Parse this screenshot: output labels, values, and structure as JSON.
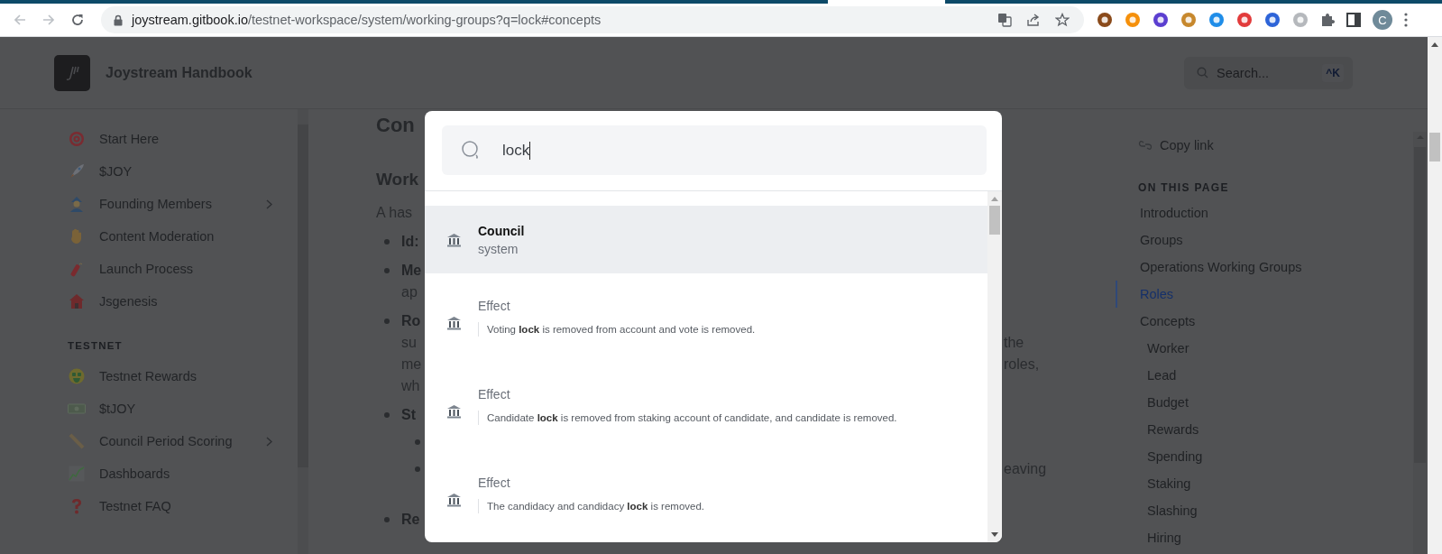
{
  "browser": {
    "url_host": "joystream.gitbook.io",
    "url_path": "/testnet-workspace/system/working-groups?q=lock#concepts",
    "profile_initial": "C"
  },
  "header": {
    "title": "Joystream Handbook",
    "search_placeholder": "Search...",
    "shortcut": "^K"
  },
  "sidebar": {
    "items": [
      {
        "label": "Start Here",
        "expandable": false
      },
      {
        "label": "$JOY",
        "expandable": false
      },
      {
        "label": "Founding Members",
        "expandable": true
      },
      {
        "label": "Content Moderation",
        "expandable": false
      },
      {
        "label": "Launch Process",
        "expandable": false
      },
      {
        "label": "Jsgenesis",
        "expandable": false
      }
    ],
    "section": "TESTNET",
    "section_items": [
      {
        "label": "Testnet Rewards",
        "expandable": false
      },
      {
        "label": "$tJOY",
        "expandable": false
      },
      {
        "label": "Council Period Scoring",
        "expandable": true
      },
      {
        "label": "Dashboards",
        "expandable": false
      },
      {
        "label": "Testnet FAQ",
        "expandable": false
      }
    ]
  },
  "article": {
    "rows": [
      {
        "kind": "h1",
        "left": "Con"
      },
      {
        "kind": "h2",
        "left": "Work"
      },
      {
        "kind": "para",
        "left": "A has"
      },
      {
        "kind": "bullet",
        "left": "Id:"
      },
      {
        "kind": "bullet",
        "left": "Me"
      },
      {
        "kind": "cont",
        "left": "ap"
      },
      {
        "kind": "bullet",
        "left": "Ro"
      },
      {
        "kind": "cont",
        "left": "su",
        "right": "the"
      },
      {
        "kind": "cont",
        "left": "me",
        "right": "roles,"
      },
      {
        "kind": "cont",
        "left": "wh"
      },
      {
        "kind": "bullet",
        "left": "St"
      },
      {
        "kind": "sub"
      },
      {
        "kind": "sub",
        "right": "eaving"
      },
      {
        "kind": "bullet",
        "left": "Re"
      }
    ]
  },
  "search_modal": {
    "query": "lock",
    "results": [
      {
        "kind": "page",
        "title": "Council",
        "subtitle": "system",
        "selected": true
      },
      {
        "kind": "section",
        "title": "Effect",
        "excerpt": "Voting **lock** is removed from account and vote is removed.",
        "selected": false
      },
      {
        "kind": "section",
        "title": "Effect",
        "excerpt": "Candidate **lock** is removed from staking account of candidate, and candidate is removed.",
        "selected": false
      },
      {
        "kind": "section",
        "title": "Effect",
        "excerpt": "The candidacy and candidacy **lock** is removed.",
        "selected": false
      }
    ]
  },
  "toc": {
    "copy_link": "Copy link",
    "heading": "ON THIS PAGE",
    "items": [
      {
        "label": "Introduction",
        "selected": false
      },
      {
        "label": "Groups",
        "selected": false
      },
      {
        "label": "Operations Working Groups",
        "selected": false
      },
      {
        "label": "Roles",
        "selected": true
      },
      {
        "label": "Concepts",
        "selected": false,
        "children": [
          {
            "label": "Worker",
            "selected": false
          },
          {
            "label": "Lead",
            "selected": false
          },
          {
            "label": "Budget",
            "selected": false
          },
          {
            "label": "Rewards",
            "selected": false
          },
          {
            "label": "Spending",
            "selected": false
          },
          {
            "label": "Staking",
            "selected": false
          },
          {
            "label": "Slashing",
            "selected": false
          },
          {
            "label": "Hiring",
            "selected": false
          }
        ]
      }
    ]
  }
}
